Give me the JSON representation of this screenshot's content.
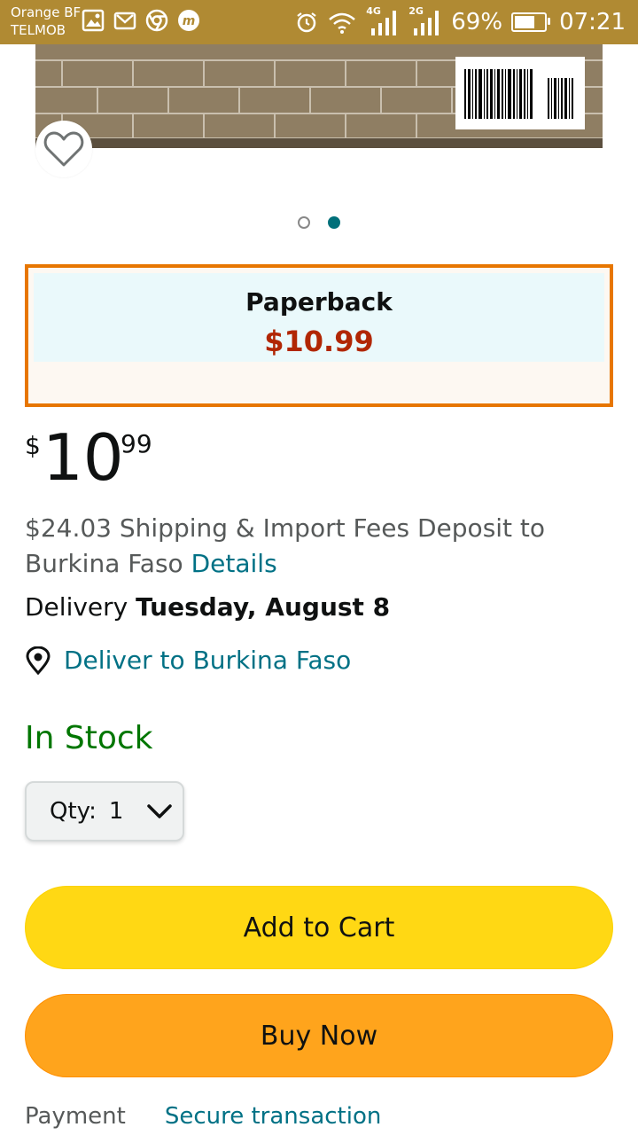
{
  "status_bar": {
    "carrier_line1": "Orange BF",
    "carrier_line2": "TELMOB",
    "network1": "4G",
    "network2": "2G",
    "battery_percent": "69%",
    "battery_level": 0.69,
    "time": "07:21",
    "bg_color": "#b08a33"
  },
  "gallery": {
    "dot_count": 2,
    "active_dot": 2
  },
  "format_option": {
    "name": "Paperback",
    "price": "$10.99",
    "border_color": "#e77600",
    "price_color": "#b12704"
  },
  "price": {
    "symbol": "$",
    "whole": "10",
    "fraction": "99"
  },
  "shipping": {
    "text": "$24.03 Shipping & Import Fees Deposit to Burkina Faso",
    "details_link": "Details"
  },
  "delivery": {
    "label": "Delivery",
    "date": "Tuesday, August 8"
  },
  "deliver_to": {
    "label": "Deliver to Burkina Faso"
  },
  "stock": {
    "status": "In Stock",
    "color": "#007600"
  },
  "quantity": {
    "label": "Qty:",
    "value": "1"
  },
  "buttons": {
    "add_to_cart": "Add to Cart",
    "buy_now": "Buy Now",
    "add_to_cart_color": "#ffd814",
    "buy_now_color": "#ffa41c"
  },
  "payment": {
    "label": "Payment",
    "value": "Secure transaction"
  },
  "icons": {
    "gallery": "gallery-icon",
    "gmail": "mail-icon",
    "chrome": "chrome-icon",
    "app": "m-app-icon",
    "alarm": "alarm-icon",
    "wifi": "wifi-icon",
    "signal": "signal-icon",
    "wishlist": "heart-icon",
    "location": "location-pin-icon",
    "qty": "chevron-down-icon"
  }
}
